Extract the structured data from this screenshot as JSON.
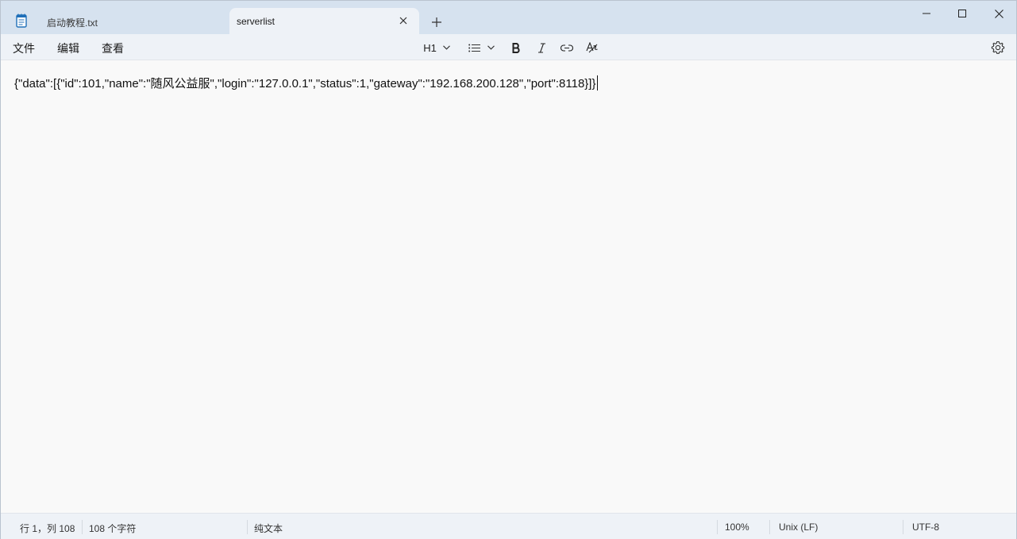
{
  "tabs": [
    {
      "label": "启动教程.txt",
      "active": false
    },
    {
      "label": "serverlist",
      "active": true
    }
  ],
  "menu": [
    "文件",
    "编辑",
    "查看"
  ],
  "toolbar": {
    "heading": "H1",
    "icons": [
      "heading-dropdown",
      "list-icon",
      "bold-icon",
      "italic-icon",
      "link-icon",
      "clear-format-icon",
      "gear-icon"
    ]
  },
  "editor": {
    "content": "{\"data\":[{\"id\":101,\"name\":\"随风公益服\",\"login\":\"127.0.0.1\",\"status\":1,\"gateway\":\"192.168.200.128\",\"port\":8118}]}"
  },
  "status": {
    "position": "行 1，列 108",
    "chars": "108 个字符",
    "format": "纯文本",
    "zoom": "100%",
    "line_ending": "Unix (LF)",
    "encoding": "UTF-8"
  },
  "colors": {
    "titlebar": "#d6e2ef",
    "toolbar": "#eef2f7",
    "editor": "#f9f9f9",
    "notepad_icon": "#1f6fb8"
  }
}
